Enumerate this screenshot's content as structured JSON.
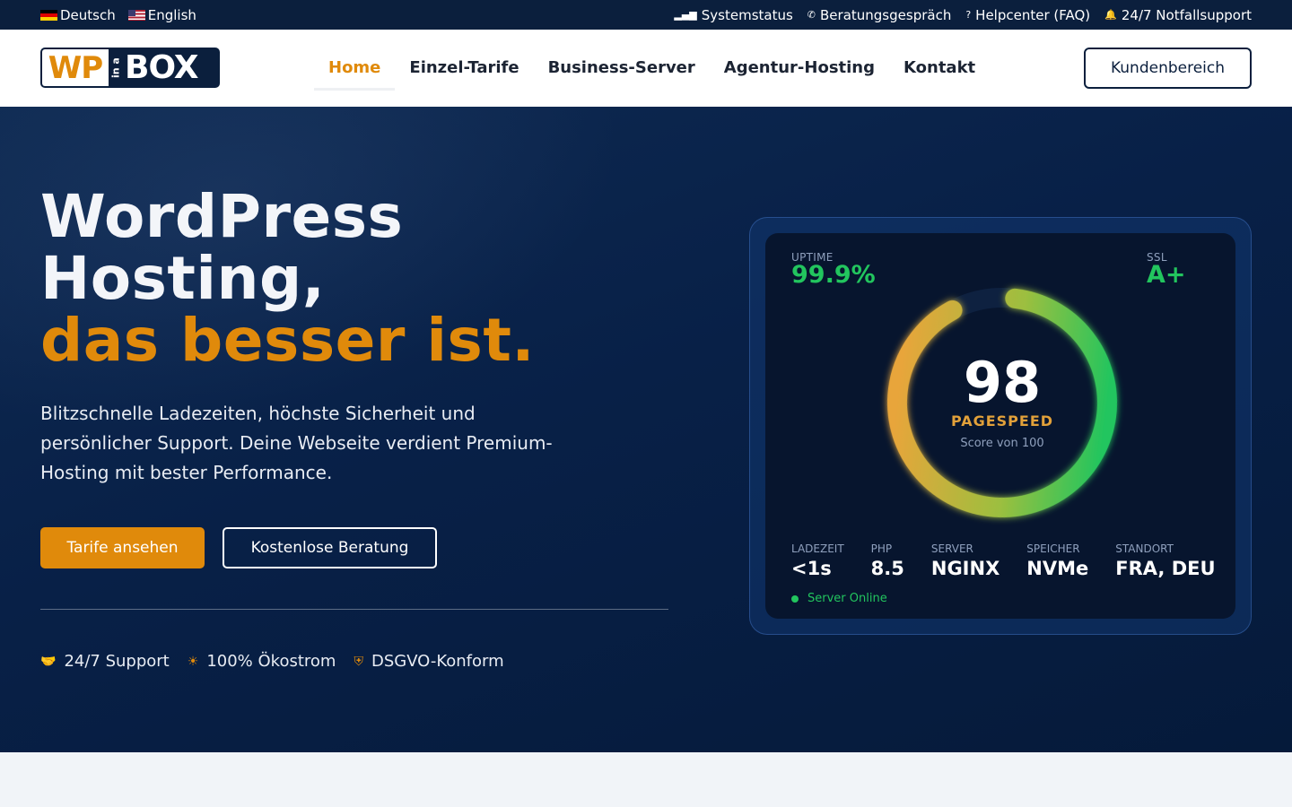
{
  "topbar": {
    "languages": [
      {
        "label": "Deutsch",
        "flag": "de-flag"
      },
      {
        "label": "English",
        "flag": "us-flag"
      }
    ],
    "links": [
      {
        "label": "Systemstatus",
        "icon": "signal-icon"
      },
      {
        "label": "Beratungsgespräch",
        "icon": "phone-icon"
      },
      {
        "label": "Helpcenter (FAQ)",
        "icon": "question-circle-icon"
      },
      {
        "label": "24/7 Notfallsupport",
        "icon": "bell-icon"
      }
    ]
  },
  "logo": {
    "wp": "WP",
    "ina": "in a",
    "box": "BOX"
  },
  "nav": {
    "items": [
      {
        "label": "Home",
        "active": true
      },
      {
        "label": "Einzel-Tarife"
      },
      {
        "label": "Business-Server"
      },
      {
        "label": "Agentur-Hosting"
      },
      {
        "label": "Kontakt"
      }
    ],
    "account_button": "Kundenbereich"
  },
  "hero": {
    "title_line1": "WordPress",
    "title_line2": "Hosting,",
    "title_accent": "das besser ist.",
    "lead": "Blitzschnelle Ladezeiten, höchste Sicherheit und persönlicher Support. Deine Webseite verdient Premium-Hosting mit bester Performance.",
    "primary_button": "Tarife ansehen",
    "secondary_button": "Kostenlose Beratung",
    "features": [
      {
        "label": "24/7 Support",
        "icon": "handshake-icon"
      },
      {
        "label": "100% Ökostrom",
        "icon": "sun-icon"
      },
      {
        "label": "DSGVO-Konform",
        "icon": "shield-user-icon"
      }
    ]
  },
  "card": {
    "uptime_label": "UPTIME",
    "uptime_value": "99.9%",
    "ssl_label": "SSL",
    "ssl_value": "A+",
    "score": "98",
    "score_fraction": 0.98,
    "score_title": "PAGESPEED",
    "score_sub": "Score von 100",
    "metrics": [
      {
        "label": "LADEZEIT",
        "value": "<1s"
      },
      {
        "label": "PHP",
        "value": "8.5"
      },
      {
        "label": "SERVER",
        "value": "NGINX"
      },
      {
        "label": "SPEICHER",
        "value": "NVMe"
      },
      {
        "label": "STANDORT",
        "value": "FRA, DEU"
      }
    ],
    "status": "Server Online"
  },
  "colors": {
    "accent": "#e08a0b",
    "navy": "#0b1f3d",
    "green": "#22c55e"
  }
}
